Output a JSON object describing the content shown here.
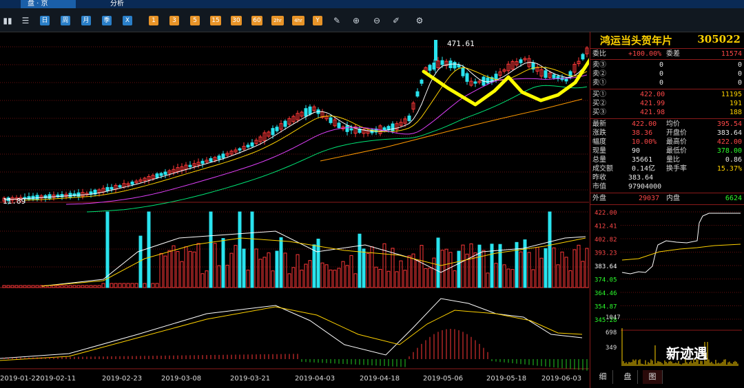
{
  "topbar": {
    "tabs": [
      "盘 · 京",
      "分析"
    ]
  },
  "toolbar": {
    "period_buttons": [
      "日",
      "周",
      "月",
      "季",
      "X"
    ],
    "minute_buttons": [
      "1",
      "3",
      "5",
      "15",
      "30",
      "60",
      "2hr",
      "4hr",
      "Y"
    ]
  },
  "stock": {
    "name": "鸿运当头贺年片",
    "code": "305022"
  },
  "quote": {
    "weibi_label": "委比",
    "weibi": "+100.00%",
    "weicha_label": "委差",
    "weicha": "11574",
    "sells": [
      {
        "label": "卖③",
        "price": "0",
        "vol": "0"
      },
      {
        "label": "卖②",
        "price": "0",
        "vol": "0"
      },
      {
        "label": "卖①",
        "price": "0",
        "vol": "0"
      }
    ],
    "buys": [
      {
        "label": "买①",
        "price": "422.00",
        "vol": "11195"
      },
      {
        "label": "买②",
        "price": "421.99",
        "vol": "191"
      },
      {
        "label": "买③",
        "price": "421.98",
        "vol": "188"
      }
    ],
    "stats": [
      {
        "l1": "最新",
        "v1": "422.00",
        "l2": "均价",
        "v2": "395.54",
        "c1": "red",
        "c2": "red"
      },
      {
        "l1": "涨跌",
        "v1": "38.36",
        "l2": "开盘价",
        "v2": "383.64",
        "c1": "red",
        "c2": "white"
      },
      {
        "l1": "幅度",
        "v1": "10.00%",
        "l2": "最高价",
        "v2": "422.00",
        "c1": "red",
        "c2": "red"
      },
      {
        "l1": "现量",
        "v1": "90",
        "l2": "最低价",
        "v2": "378.00",
        "c1": "white",
        "c2": "green"
      },
      {
        "l1": "总量",
        "v1": "35661",
        "l2": "量比",
        "v2": "0.86",
        "c1": "white",
        "c2": "white"
      },
      {
        "l1": "成交额",
        "v1": "0.14亿",
        "l2": "换手率",
        "v2": "15.37%",
        "c1": "white",
        "c2": "yellow"
      }
    ],
    "zuoshou_label": "昨收",
    "zuoshou": "383.64",
    "shizhi_label": "市值",
    "shizhi": "97904000",
    "waipan_label": "外盘",
    "waipan": "29037",
    "neipan_label": "内盘",
    "neipan": "6624"
  },
  "intraday": {
    "price_ticks": [
      "422.00",
      "412.41",
      "402.82",
      "393.23",
      "383.64",
      "374.05",
      "364.46",
      "354.87",
      "345.28"
    ],
    "vol_ticks": [
      "1047",
      "698",
      "349"
    ]
  },
  "bottom_tabs": [
    "细",
    "盘",
    "图"
  ],
  "watermark": "新迹遇",
  "chart_labels": {
    "high": "471.61",
    "low": "11.89"
  },
  "dates": [
    "2019-01-22",
    "2019-02-11",
    "2019-02-23",
    "2019-03-08",
    "2019-03-21",
    "2019-04-03",
    "2019-04-18",
    "2019-05-06",
    "2019-05-18",
    "2019-06-03"
  ],
  "colors": {
    "up": "#ff3838",
    "down": "#29e3ee",
    "ma5": "#ffffff",
    "ma10": "#ffd200",
    "ma20": "#e040fb",
    "ma30": "#00e676",
    "ma60": "#ff9800",
    "annotation": "#ffff00"
  },
  "chart_data": [
    {
      "type": "candlestick",
      "x": [
        "2019-01-22",
        "2019-02-11",
        "2019-02-23",
        "2019-03-08",
        "2019-03-21",
        "2019-04-03",
        "2019-04-18",
        "2019-05-06",
        "2019-05-18",
        "2019-06-03"
      ],
      "close": [
        11.89,
        30,
        90,
        160,
        260,
        250,
        240,
        390,
        360,
        422
      ],
      "high_label": 471.61,
      "low_label": 11.89
    },
    {
      "type": "bar",
      "name": "volume",
      "values": [
        5,
        8,
        60,
        55,
        45,
        62,
        40,
        30,
        55,
        48
      ]
    },
    {
      "type": "line",
      "name": "macd",
      "values": [
        0.1,
        0.2,
        0.45,
        0.6,
        0.7,
        0.55,
        0.4,
        0.9,
        0.6,
        0.35
      ]
    }
  ]
}
